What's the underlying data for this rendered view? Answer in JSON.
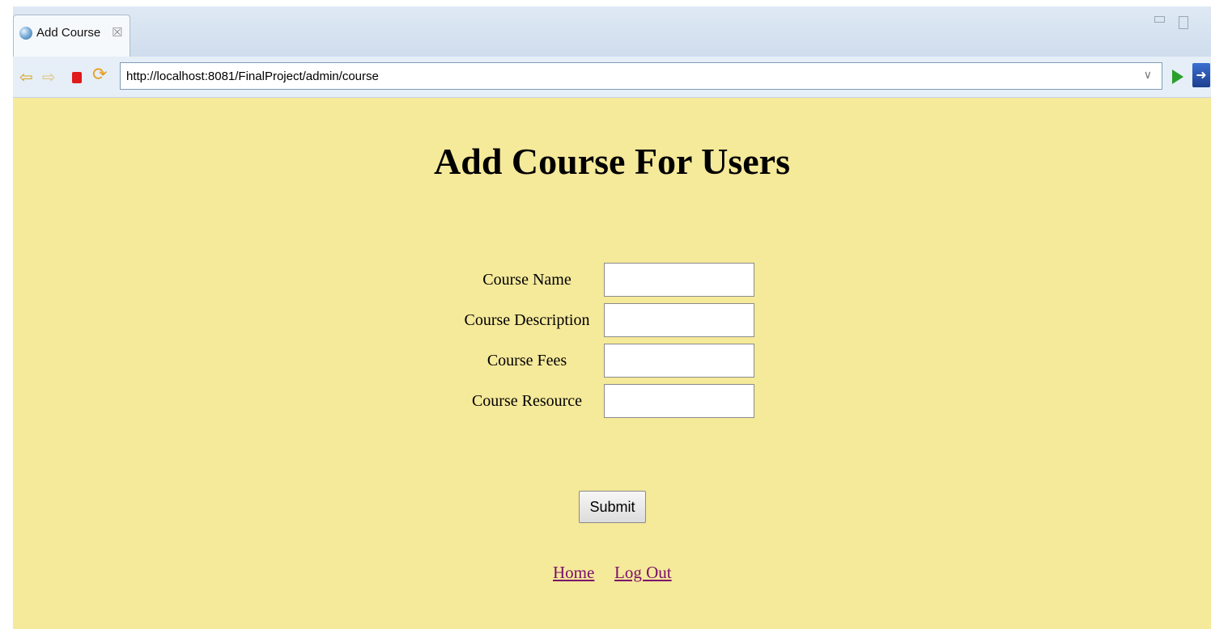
{
  "tab": {
    "title": "Add Course",
    "close": "☒"
  },
  "navigation": {
    "url": "http://localhost:8081/FinalProject/admin/course"
  },
  "page": {
    "heading": "Add Course For Users",
    "form": {
      "fields": [
        {
          "label": "Course Name",
          "value": ""
        },
        {
          "label": "Course Description",
          "value": ""
        },
        {
          "label": "Course Fees",
          "value": ""
        },
        {
          "label": "Course Resource",
          "value": ""
        }
      ],
      "submit_label": "Submit"
    },
    "links": {
      "home": "Home",
      "logout": "Log Out"
    }
  },
  "colors": {
    "page_background": "#f5e99a",
    "link": "#7a0f6b",
    "tab_bar": "#dfe9f4"
  },
  "icons": [
    "globe-icon",
    "back-arrow-icon",
    "forward-arrow-icon",
    "stop-icon",
    "refresh-icon",
    "dropdown-icon",
    "go-icon",
    "external-browser-icon",
    "minimize-icon",
    "maximize-icon"
  ]
}
